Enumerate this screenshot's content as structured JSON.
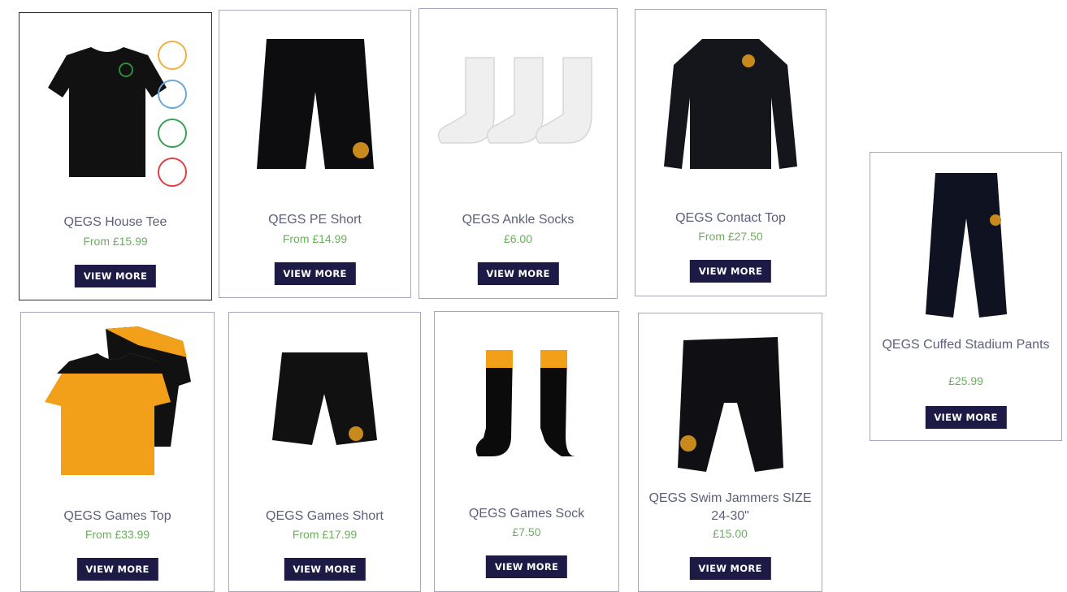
{
  "products": [
    {
      "title": "QEGS House Tee",
      "price": "From £15.99",
      "button": "VIEW MORE",
      "image": "house-tee-icon"
    },
    {
      "title": "QEGS PE Short",
      "price": "From £14.99",
      "button": "VIEW MORE",
      "image": "pe-short-icon"
    },
    {
      "title": "QEGS Ankle Socks",
      "price": "£6.00",
      "button": "VIEW MORE",
      "image": "ankle-socks-icon"
    },
    {
      "title": "QEGS Contact Top",
      "price": "From £27.50",
      "button": "VIEW MORE",
      "image": "contact-top-icon"
    },
    {
      "title": "QEGS Cuffed Stadium Pants",
      "price": "£25.99",
      "button": "VIEW MORE",
      "image": "stadium-pants-icon"
    },
    {
      "title": "QEGS Games Top",
      "price": "From £33.99",
      "button": "VIEW MORE",
      "image": "games-top-icon"
    },
    {
      "title": "QEGS Games Short",
      "price": "From £17.99",
      "button": "VIEW MORE",
      "image": "games-short-icon"
    },
    {
      "title": "QEGS Games Sock",
      "price": "£7.50",
      "button": "VIEW MORE",
      "image": "games-sock-icon"
    },
    {
      "title": "QEGS Swim Jammers SIZE 24-30\"",
      "price": "£15.00",
      "button": "VIEW MORE",
      "image": "swim-jammers-icon"
    }
  ],
  "colors": {
    "button_bg": "#1d1a45",
    "price_green": "#6cae5e",
    "title_text": "#5c5f7a",
    "card_border": "#a8a6bd",
    "kit_orange": "#f2a01a"
  }
}
